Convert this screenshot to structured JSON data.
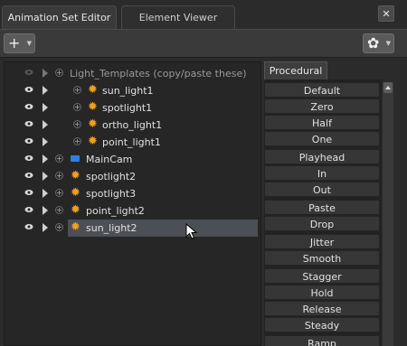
{
  "tabs": {
    "active_label": "Animation Set Editor",
    "inactive_label": "Element Viewer",
    "close_label": "✕"
  },
  "toolbar": {
    "add_label": "+",
    "gear_label": "✿"
  },
  "tree": {
    "items": [
      {
        "label": "Light_Templates (copy/paste these)",
        "icon": "none"
      },
      {
        "label": "sun_light1",
        "icon": "light-icon"
      },
      {
        "label": "spotlight1",
        "icon": "light-icon"
      },
      {
        "label": "ortho_light1",
        "icon": "light-icon"
      },
      {
        "label": "point_light1",
        "icon": "light-icon"
      },
      {
        "label": "MainCam",
        "icon": "camera-icon"
      },
      {
        "label": "spotlight2",
        "icon": "light-icon"
      },
      {
        "label": "spotlight3",
        "icon": "light-icon"
      },
      {
        "label": "point_light2",
        "icon": "light-icon"
      },
      {
        "label": "sun_light2",
        "icon": "light-icon"
      }
    ]
  },
  "procedural": {
    "tab_label": "Procedural",
    "buttons": [
      "Default",
      "Zero",
      "Half",
      "One",
      "Playhead",
      "In",
      "Out",
      "Paste",
      "Drop",
      "Jitter",
      "Smooth",
      "Stagger",
      "Hold",
      "Release",
      "Steady",
      "Ramp"
    ]
  },
  "colors": {
    "light_icon": "#f0a020",
    "camera_icon": "#2f7fe0",
    "selection": "#4c4f55"
  }
}
